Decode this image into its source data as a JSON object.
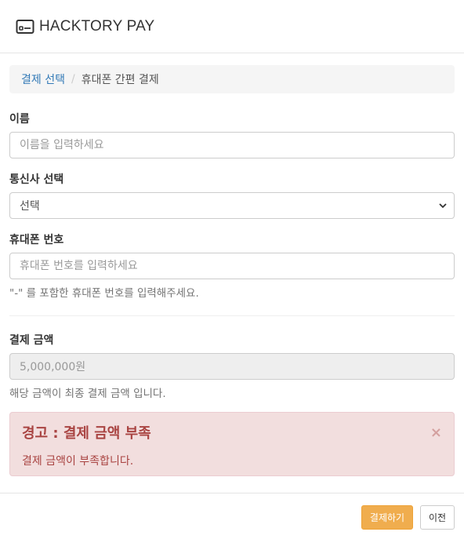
{
  "header": {
    "title": "HACKTORY PAY",
    "icon": "credit-card-icon"
  },
  "breadcrumb": {
    "link_label": "결제 선택",
    "separator": "/",
    "current_label": "휴대폰 간편 결제"
  },
  "form": {
    "name": {
      "label": "이름",
      "placeholder": "이름을 입력하세요",
      "value": ""
    },
    "carrier": {
      "label": "통신사 선택",
      "selected": "선택"
    },
    "phone": {
      "label": "휴대폰 번호",
      "placeholder": "휴대폰 번호를 입력하세요",
      "value": "",
      "help": "\"-\" 를 포함한 휴대폰 번호를 입력해주세요."
    },
    "amount": {
      "label": "결제 금액",
      "value": "5,000,000원",
      "help": "해당 금액이 최종 결제 금액 입니다."
    }
  },
  "alert": {
    "title": "경고 : 결제 금액 부족",
    "message": "결제 금액이 부족합니다.",
    "close_symbol": "×",
    "color": "#a94442",
    "background": "#f2dede"
  },
  "footer": {
    "pay_label": "결제하기",
    "prev_label": "이전",
    "accent": "#f0ad4e"
  }
}
